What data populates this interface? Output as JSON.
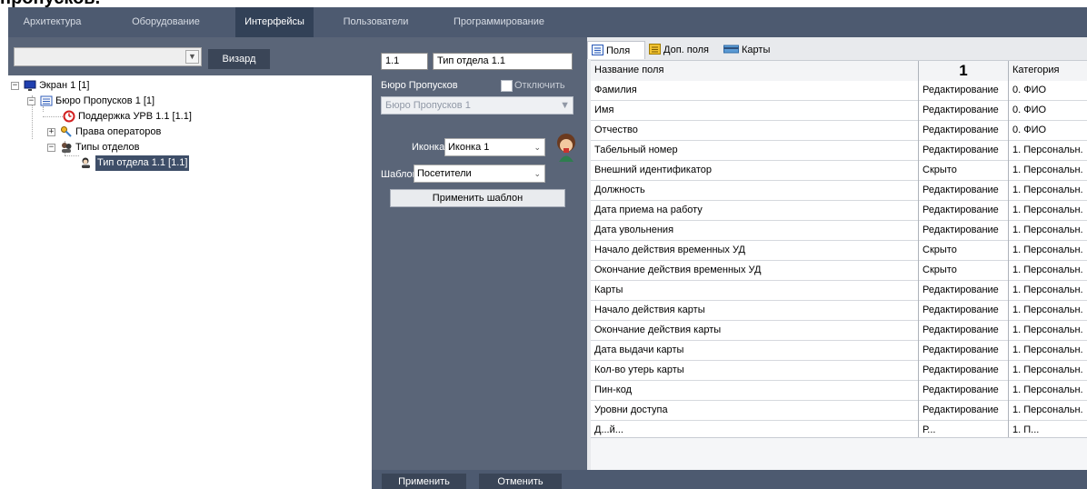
{
  "heading": "пропусков.",
  "nav": {
    "tabs": [
      "Архитектура",
      "Оборудование",
      "Интерфейсы",
      "Пользователи",
      "Программирование"
    ],
    "active": "Интерфейсы"
  },
  "left": {
    "wizard_label": "Визард",
    "tree": [
      {
        "label": "Экран 1 [1]",
        "icon": "screen-icon"
      },
      {
        "label": "Бюро Пропусков 1 [1]",
        "icon": "pass-office-icon"
      },
      {
        "label": "Поддержка УРВ 1.1 [1.1]",
        "icon": "clock-icon"
      },
      {
        "label": "Права операторов",
        "icon": "key-icon"
      },
      {
        "label": "Типы отделов",
        "icon": "department-types-icon"
      },
      {
        "label": "Тип отдела 1.1 [1.1]",
        "icon": "department-type-icon"
      }
    ]
  },
  "middle": {
    "id_value": "1.1",
    "name_value": "Тип отдела 1.1",
    "pass_office_label": "Бюро Пропусков",
    "disable_label": "Отключить",
    "pass_office_value": "Бюро Пропусков 1",
    "icon_label": "Иконка",
    "icon_value": "Иконка 1",
    "template_label": "Шаблон",
    "template_value": "Посетители",
    "apply_template_label": "Применить шаблон"
  },
  "right": {
    "tabs": [
      {
        "label": "Поля",
        "icon": "fields-icon"
      },
      {
        "label": "Доп. поля",
        "icon": "extra-fields-icon"
      },
      {
        "label": "Карты",
        "icon": "cards-icon"
      }
    ],
    "columns": [
      "Название поля",
      "1",
      "Категория"
    ],
    "rows": [
      [
        "Фамилия",
        "Редактирование",
        "0. ФИО"
      ],
      [
        "Имя",
        "Редактирование",
        "0. ФИО"
      ],
      [
        "Отчество",
        "Редактирование",
        "0. ФИО"
      ],
      [
        "Табельный номер",
        "Редактирование",
        "1. Персональн."
      ],
      [
        "Внешний идентификатор",
        "Скрыто",
        "1. Персональн."
      ],
      [
        "Должность",
        "Редактирование",
        "1. Персональн."
      ],
      [
        "Дата приема на работу",
        "Редактирование",
        "1. Персональн."
      ],
      [
        "Дата увольнения",
        "Редактирование",
        "1. Персональн."
      ],
      [
        "Начало действия временных УД",
        "Скрыто",
        "1. Персональн."
      ],
      [
        "Окончание действия временных УД",
        "Скрыто",
        "1. Персональн."
      ],
      [
        "Карты",
        "Редактирование",
        "1. Персональн."
      ],
      [
        "Начало действия карты",
        "Редактирование",
        "1. Персональн."
      ],
      [
        "Окончание действия карты",
        "Редактирование",
        "1. Персональн."
      ],
      [
        "Дата выдачи карты",
        "Редактирование",
        "1. Персональн."
      ],
      [
        "Кол-во утерь карты",
        "Редактирование",
        "1. Персональн."
      ],
      [
        "Пин-код",
        "Редактирование",
        "1. Персональн."
      ],
      [
        "Уровни доступа",
        "Редактирование",
        "1. Персональн."
      ],
      [
        "Д...й...",
        "Р...",
        "1. П..."
      ]
    ]
  },
  "bottom": {
    "apply_label": "Применить",
    "cancel_label": "Отменить"
  },
  "colors": {
    "nav_bg": "#4d5a70",
    "nav_active": "#324157",
    "panel_bg": "#5a6578",
    "selection": "#3e4e68"
  }
}
